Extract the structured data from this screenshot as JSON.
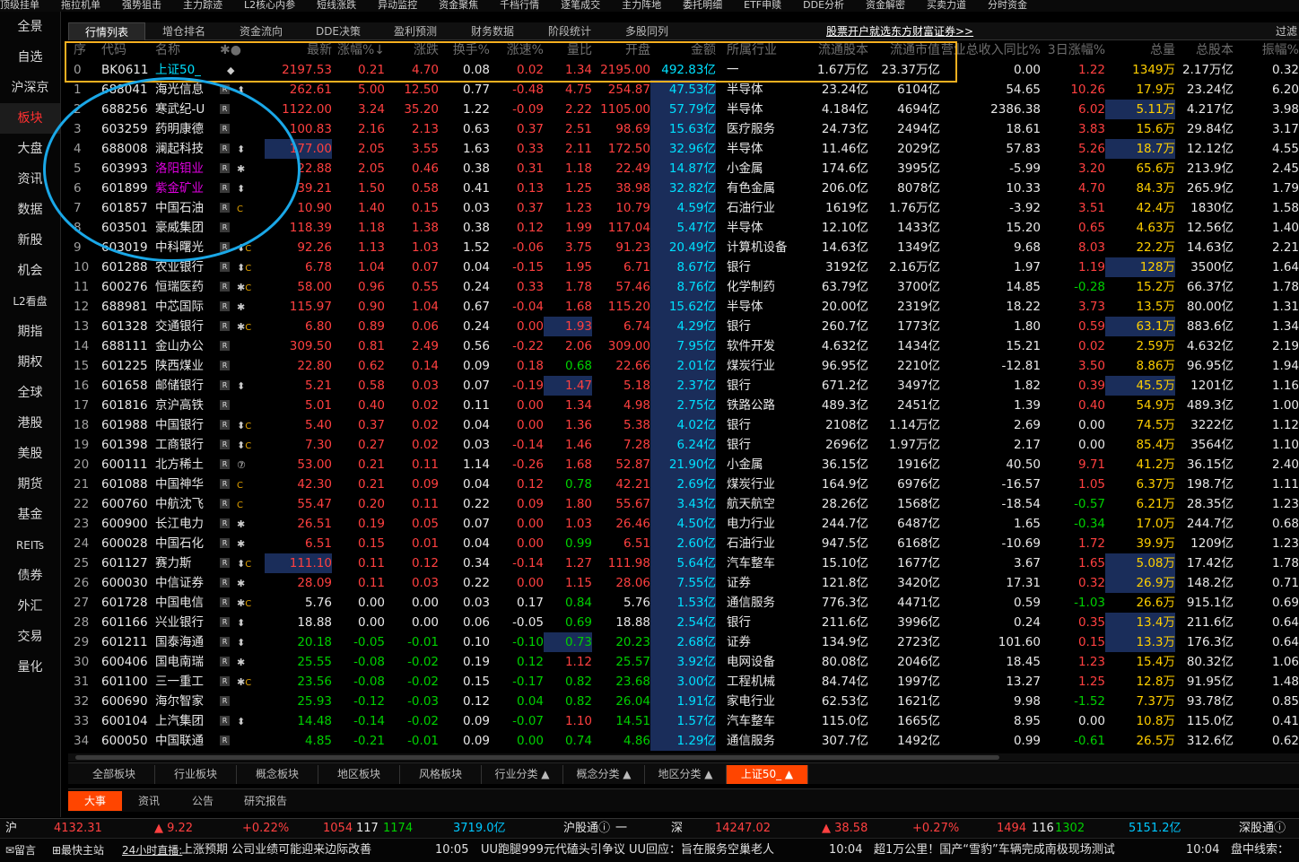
{
  "top_menu": [
    "顶级挂单",
    "拖拉机单",
    "强势狙击",
    "主力踪迹",
    "L2核心内参",
    "短线涨跌",
    "异动监控",
    "资金聚焦",
    "千档行情",
    "逐笔成交",
    "主力阵地",
    "委托明细",
    "ETF申赎",
    "DDE分析",
    "资金解密",
    "买卖力道",
    "分时资金"
  ],
  "sidebar": [
    "全景",
    "自选",
    "沪深京",
    "板块",
    "大盘",
    "资讯",
    "数据",
    "新股",
    "机会",
    "L2看盘",
    "期指",
    "期权",
    "全球",
    "港股",
    "美股",
    "期货",
    "基金",
    "REITs",
    "债券",
    "外汇",
    "交易",
    "量化"
  ],
  "sidebar_active": "板块",
  "tabs": [
    "行情列表",
    "增仓排名",
    "资金流向",
    "DDE决策",
    "盈利预测",
    "财务数据",
    "阶段统计",
    "多股同列"
  ],
  "tab_active": "行情列表",
  "promo": "股票开户就选东方财富证券>>",
  "filter_label": "过滤",
  "headers": [
    "序",
    "代码",
    "名称",
    "✱●",
    "最新",
    "涨幅%↓",
    "涨跌",
    "换手%",
    "涨速%",
    "量比",
    "开盘",
    "金额",
    "所属行业",
    "流通股本",
    "流通市值",
    "营业总收入同比%",
    "3日涨幅%",
    "总量",
    "总股本",
    "振幅%"
  ],
  "rows": [
    [
      "0",
      "BK0611",
      "上证50_",
      "◆",
      "2197.53",
      "0.21",
      "4.70",
      "0.08",
      "0.02",
      "1.34",
      "2195.00",
      "492.83亿",
      "一",
      "1.67万亿",
      "23.37万亿",
      "0.00",
      "1.22",
      "1349万",
      "2.17万亿",
      "0.32"
    ],
    [
      "1",
      "688041",
      "海光信息",
      "⬍",
      "262.61",
      "5.00",
      "12.50",
      "0.77",
      "-0.48",
      "4.75",
      "254.87",
      "47.53亿",
      "半导体",
      "23.24亿",
      "6104亿",
      "54.65",
      "10.26",
      "17.9万",
      "23.24亿",
      "6.20"
    ],
    [
      "2",
      "688256",
      "寒武纪-U",
      "",
      "1122.00",
      "3.24",
      "35.20",
      "1.22",
      "-0.09",
      "2.22",
      "1105.00",
      "57.79亿",
      "半导体",
      "4.184亿",
      "4694亿",
      "2386.38",
      "6.02",
      "5.11万",
      "4.217亿",
      "3.98"
    ],
    [
      "3",
      "603259",
      "药明康德",
      "",
      "100.83",
      "2.16",
      "2.13",
      "0.63",
      "0.37",
      "2.51",
      "98.69",
      "15.63亿",
      "医疗服务",
      "24.73亿",
      "2494亿",
      "18.61",
      "3.83",
      "15.6万",
      "29.84亿",
      "3.17"
    ],
    [
      "4",
      "688008",
      "澜起科技",
      "⬍",
      "177.00",
      "2.05",
      "3.55",
      "1.63",
      "0.33",
      "2.11",
      "172.50",
      "32.96亿",
      "半导体",
      "11.46亿",
      "2029亿",
      "57.83",
      "5.26",
      "18.7万",
      "12.12亿",
      "4.55"
    ],
    [
      "5",
      "603993",
      "洛阳钼业",
      "✱",
      "22.88",
      "2.05",
      "0.46",
      "0.38",
      "0.31",
      "1.18",
      "22.49",
      "14.87亿",
      "小金属",
      "174.6亿",
      "3995亿",
      "-5.99",
      "3.20",
      "65.6万",
      "213.9亿",
      "2.45"
    ],
    [
      "6",
      "601899",
      "紫金矿业",
      "⬍",
      "39.21",
      "1.50",
      "0.58",
      "0.41",
      "0.13",
      "1.25",
      "38.98",
      "32.82亿",
      "有色金属",
      "206.0亿",
      "8078亿",
      "10.33",
      "4.70",
      "84.3万",
      "265.9亿",
      "1.79"
    ],
    [
      "7",
      "601857",
      "中国石油",
      "C",
      "10.90",
      "1.40",
      "0.15",
      "0.03",
      "0.37",
      "1.23",
      "10.79",
      "4.59亿",
      "石油行业",
      "1619亿",
      "1.76万亿",
      "-3.92",
      "3.51",
      "42.4万",
      "1830亿",
      "1.58"
    ],
    [
      "8",
      "603501",
      "豪威集团",
      "",
      "118.39",
      "1.18",
      "1.38",
      "0.38",
      "0.12",
      "1.99",
      "117.04",
      "5.47亿",
      "半导体",
      "12.10亿",
      "1433亿",
      "15.20",
      "0.65",
      "4.63万",
      "12.56亿",
      "1.40"
    ],
    [
      "9",
      "603019",
      "中科曙光",
      "⬍C",
      "92.26",
      "1.13",
      "1.03",
      "1.52",
      "-0.06",
      "3.75",
      "91.23",
      "20.49亿",
      "计算机设备",
      "14.63亿",
      "1349亿",
      "9.68",
      "8.03",
      "22.2万",
      "14.63亿",
      "2.21"
    ],
    [
      "10",
      "601288",
      "农业银行",
      "⬍C",
      "6.78",
      "1.04",
      "0.07",
      "0.04",
      "-0.15",
      "1.95",
      "6.71",
      "8.67亿",
      "银行",
      "3192亿",
      "2.16万亿",
      "1.97",
      "1.19",
      "128万",
      "3500亿",
      "1.64"
    ],
    [
      "11",
      "600276",
      "恒瑞医药",
      "✱C",
      "58.00",
      "0.96",
      "0.55",
      "0.24",
      "0.33",
      "1.78",
      "57.46",
      "8.76亿",
      "化学制药",
      "63.79亿",
      "3700亿",
      "14.85",
      "-0.28",
      "15.2万",
      "66.37亿",
      "1.78"
    ],
    [
      "12",
      "688981",
      "中芯国际",
      "✱",
      "115.97",
      "0.90",
      "1.04",
      "0.67",
      "-0.04",
      "1.68",
      "115.20",
      "15.62亿",
      "半导体",
      "20.00亿",
      "2319亿",
      "18.22",
      "3.73",
      "13.5万",
      "80.00亿",
      "1.31"
    ],
    [
      "13",
      "601328",
      "交通银行",
      "✱C",
      "6.80",
      "0.89",
      "0.06",
      "0.24",
      "0.00",
      "1.93",
      "6.74",
      "4.29亿",
      "银行",
      "260.7亿",
      "1773亿",
      "1.80",
      "0.59",
      "63.1万",
      "883.6亿",
      "1.34"
    ],
    [
      "14",
      "688111",
      "金山办公",
      "",
      "309.50",
      "0.81",
      "2.49",
      "0.56",
      "-0.22",
      "2.06",
      "309.00",
      "7.95亿",
      "软件开发",
      "4.632亿",
      "1434亿",
      "15.21",
      "0.02",
      "2.59万",
      "4.632亿",
      "2.19"
    ],
    [
      "15",
      "601225",
      "陕西煤业",
      "",
      "22.80",
      "0.62",
      "0.14",
      "0.09",
      "0.18",
      "0.68",
      "22.66",
      "2.01亿",
      "煤炭行业",
      "96.95亿",
      "2210亿",
      "-12.81",
      "3.50",
      "8.86万",
      "96.95亿",
      "1.94"
    ],
    [
      "16",
      "601658",
      "邮储银行",
      "⬍",
      "5.21",
      "0.58",
      "0.03",
      "0.07",
      "-0.19",
      "1.47",
      "5.18",
      "2.37亿",
      "银行",
      "671.2亿",
      "3497亿",
      "1.82",
      "0.39",
      "45.5万",
      "1201亿",
      "1.16"
    ],
    [
      "17",
      "601816",
      "京沪高铁",
      "",
      "5.01",
      "0.40",
      "0.02",
      "0.11",
      "0.00",
      "1.34",
      "4.98",
      "2.75亿",
      "铁路公路",
      "489.3亿",
      "2451亿",
      "1.39",
      "0.40",
      "54.9万",
      "489.3亿",
      "1.00"
    ],
    [
      "18",
      "601988",
      "中国银行",
      "⬍C",
      "5.40",
      "0.37",
      "0.02",
      "0.04",
      "0.00",
      "1.36",
      "5.38",
      "4.02亿",
      "银行",
      "2108亿",
      "1.14万亿",
      "2.69",
      "0.00",
      "74.5万",
      "3222亿",
      "1.12"
    ],
    [
      "19",
      "601398",
      "工商银行",
      "⬍C",
      "7.30",
      "0.27",
      "0.02",
      "0.03",
      "-0.14",
      "1.46",
      "7.28",
      "6.24亿",
      "银行",
      "2696亿",
      "1.97万亿",
      "2.17",
      "0.00",
      "85.4万",
      "3564亿",
      "1.10"
    ],
    [
      "20",
      "600111",
      "北方稀土",
      "⑦",
      "53.00",
      "0.21",
      "0.11",
      "1.14",
      "-0.26",
      "1.68",
      "52.87",
      "21.90亿",
      "小金属",
      "36.15亿",
      "1916亿",
      "40.50",
      "9.71",
      "41.2万",
      "36.15亿",
      "2.40"
    ],
    [
      "21",
      "601088",
      "中国神华",
      "C",
      "42.30",
      "0.21",
      "0.09",
      "0.04",
      "0.12",
      "0.78",
      "42.21",
      "2.69亿",
      "煤炭行业",
      "164.9亿",
      "6976亿",
      "-16.57",
      "1.05",
      "6.37万",
      "198.7亿",
      "1.11"
    ],
    [
      "22",
      "600760",
      "中航沈飞",
      "C",
      "55.47",
      "0.20",
      "0.11",
      "0.22",
      "0.09",
      "1.80",
      "55.67",
      "3.43亿",
      "航天航空",
      "28.26亿",
      "1568亿",
      "-18.54",
      "-0.57",
      "6.21万",
      "28.35亿",
      "1.23"
    ],
    [
      "23",
      "600900",
      "长江电力",
      "✱",
      "26.51",
      "0.19",
      "0.05",
      "0.07",
      "0.00",
      "1.03",
      "26.46",
      "4.50亿",
      "电力行业",
      "244.7亿",
      "6487亿",
      "1.65",
      "-0.34",
      "17.0万",
      "244.7亿",
      "0.68"
    ],
    [
      "24",
      "600028",
      "中国石化",
      "✱",
      "6.51",
      "0.15",
      "0.01",
      "0.04",
      "0.00",
      "0.99",
      "6.51",
      "2.60亿",
      "石油行业",
      "947.5亿",
      "6168亿",
      "-10.69",
      "1.72",
      "39.9万",
      "1209亿",
      "1.23"
    ],
    [
      "25",
      "601127",
      "赛力斯",
      "⬍C",
      "111.10",
      "0.11",
      "0.12",
      "0.34",
      "-0.14",
      "1.27",
      "111.98",
      "5.64亿",
      "汽车整车",
      "15.10亿",
      "1677亿",
      "3.67",
      "1.65",
      "5.08万",
      "17.42亿",
      "1.78"
    ],
    [
      "26",
      "600030",
      "中信证券",
      "✱",
      "28.09",
      "0.11",
      "0.03",
      "0.22",
      "0.00",
      "1.15",
      "28.06",
      "7.55亿",
      "证券",
      "121.8亿",
      "3420亿",
      "17.31",
      "0.32",
      "26.9万",
      "148.2亿",
      "0.71"
    ],
    [
      "27",
      "601728",
      "中国电信",
      "✱C",
      "5.76",
      "0.00",
      "0.00",
      "0.03",
      "0.17",
      "0.84",
      "5.76",
      "1.53亿",
      "通信服务",
      "776.3亿",
      "4471亿",
      "0.59",
      "-1.03",
      "26.6万",
      "915.1亿",
      "0.69"
    ],
    [
      "28",
      "601166",
      "兴业银行",
      "⬍",
      "18.88",
      "0.00",
      "0.00",
      "0.06",
      "-0.05",
      "0.69",
      "18.88",
      "2.54亿",
      "银行",
      "211.6亿",
      "3996亿",
      "0.24",
      "0.35",
      "13.4万",
      "211.6亿",
      "0.64"
    ],
    [
      "29",
      "601211",
      "国泰海通",
      "⬍",
      "20.18",
      "-0.05",
      "-0.01",
      "0.10",
      "-0.10",
      "0.73",
      "20.23",
      "2.68亿",
      "证券",
      "134.9亿",
      "2723亿",
      "101.60",
      "0.15",
      "13.3万",
      "176.3亿",
      "0.64"
    ],
    [
      "30",
      "600406",
      "国电南瑞",
      "✱",
      "25.55",
      "-0.08",
      "-0.02",
      "0.19",
      "0.12",
      "1.12",
      "25.57",
      "3.92亿",
      "电网设备",
      "80.08亿",
      "2046亿",
      "18.45",
      "1.23",
      "15.4万",
      "80.32亿",
      "1.06"
    ],
    [
      "31",
      "601100",
      "三一重工",
      "✱C",
      "23.56",
      "-0.08",
      "-0.02",
      "0.15",
      "-0.17",
      "0.82",
      "23.68",
      "3.00亿",
      "工程机械",
      "84.74亿",
      "1997亿",
      "13.27",
      "1.25",
      "12.8万",
      "91.95亿",
      "1.48"
    ],
    [
      "32",
      "600690",
      "海尔智家",
      "",
      "25.93",
      "-0.12",
      "-0.03",
      "0.12",
      "0.04",
      "0.82",
      "26.04",
      "1.91亿",
      "家电行业",
      "62.53亿",
      "1621亿",
      "9.98",
      "-1.52",
      "7.37万",
      "93.78亿",
      "0.85"
    ],
    [
      "33",
      "600104",
      "上汽集团",
      "⬍",
      "14.48",
      "-0.14",
      "-0.02",
      "0.09",
      "-0.07",
      "1.10",
      "14.51",
      "1.57亿",
      "汽车整车",
      "115.0亿",
      "1665亿",
      "8.95",
      "0.00",
      "10.8万",
      "115.0亿",
      "0.41"
    ],
    [
      "34",
      "600050",
      "中国联通",
      "",
      "4.85",
      "-0.21",
      "-0.01",
      "0.09",
      "0.00",
      "0.74",
      "4.86",
      "1.29亿",
      "通信服务",
      "307.7亿",
      "1492亿",
      "0.99",
      "-0.61",
      "26.5万",
      "312.6亿",
      "0.62"
    ]
  ],
  "bottom_tabs": [
    "全部板块",
    "行业板块",
    "概念板块",
    "地区板块",
    "风格板块",
    "行业分类 ▲",
    "概念分类 ▲",
    "地区分类 ▲",
    "上证50_ ▲"
  ],
  "bottom_tab_active": "上证50_ ▲",
  "sub_tabs": [
    "大事",
    "资讯",
    "公告",
    "研究报告"
  ],
  "sub_tab_active": "大事",
  "status": {
    "sh_label": "沪",
    "sh_index": "4132.31",
    "sh_chg": "▲ 9.22",
    "sh_pct": "+0.22%",
    "sh_up": "1054",
    "sh_flat": "117",
    "sh_down": "1174",
    "sh_amt": "3719.0亿",
    "hgt_label": "沪股通ⓘ",
    "hgt_val": "一",
    "sz_label": "深",
    "sz_index": "14247.02",
    "sz_chg": "▲ 38.58",
    "sz_pct": "+0.27%",
    "sz_up": "1494",
    "sz_flat": "116",
    "sz_down": "1302",
    "sz_amt": "5151.2亿",
    "sgt_label": "深股通ⓘ"
  },
  "ticker": {
    "msg": "✉留言",
    "quick": "⊞最快主站",
    "live": "24小时直播:",
    "n1": "上涨预期 公司业绩可能迎来边际改善",
    "t2": "10:05",
    "n2": "UU跑腿999元代磕头引争议 UU回应：旨在服务空巢老人",
    "t3": "10:04",
    "n3": "超1万公里！国产“雪豹”车辆完成南极现场测试",
    "t4": "10:04",
    "n4": "盘中线索："
  },
  "colors": {
    "up": "#ff4040",
    "down": "#00d000",
    "highlight_box": "#f6b020",
    "circle": "#1aa8e8",
    "active_tab": "#ff4500"
  }
}
